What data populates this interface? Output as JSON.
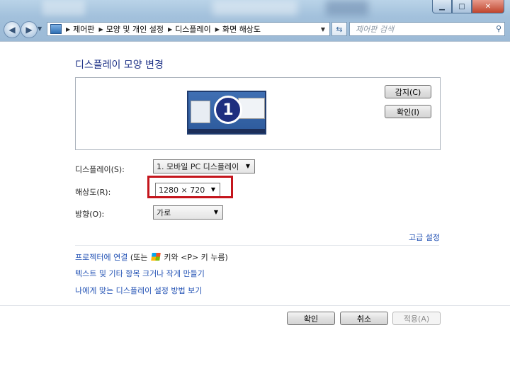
{
  "window": {
    "minimize_icon": "minimize-icon",
    "maximize_icon": "maximize-icon",
    "close_icon": "close-icon"
  },
  "nav": {
    "breadcrumb": [
      "제어판",
      "모양 및 개인 설정",
      "디스플레이",
      "화면 해상도"
    ],
    "search_placeholder": "제어판 검색"
  },
  "page": {
    "title": "디스플레이 모양 변경",
    "monitor_number": "1",
    "detect_label": "감지(C)",
    "identify_label": "확인(I)"
  },
  "settings": {
    "display_label": "디스플레이(S):",
    "display_value": "1. 모바일 PC 디스플레이",
    "resolution_label": "해상도(R):",
    "resolution_value": "1280 × 720",
    "orientation_label": "방향(O):",
    "orientation_value": "가로"
  },
  "links": {
    "advanced": "고급 설정",
    "projector_link": "프로젝터에 연결",
    "projector_hint_pre": " (또는",
    "projector_hint_post": "키와 <P> 키 누름)",
    "text_size": "텍스트 및 기타 항목 크거나 작게 만들기",
    "which_settings": "나에게 맞는 디스플레이 설정 방법 보기"
  },
  "buttons": {
    "ok": "확인",
    "cancel": "취소",
    "apply": "적용(A)"
  },
  "colors": {
    "link": "#2151b4",
    "title": "#1e3287",
    "highlight": "#c4151c"
  }
}
